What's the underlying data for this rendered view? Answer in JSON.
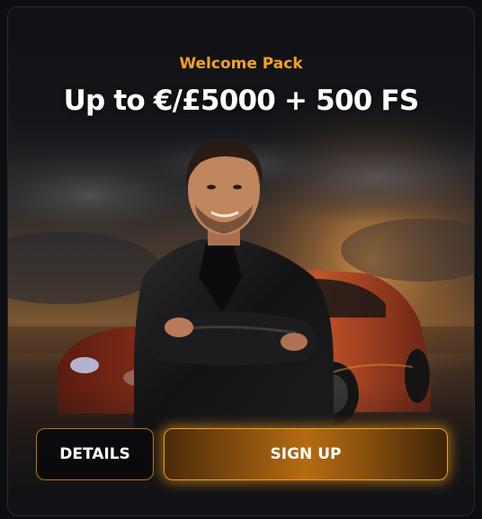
{
  "promo": {
    "eyebrow": "Welcome Pack",
    "headline": "Up to €/£5000 + 500 FS"
  },
  "actions": {
    "details_label": "DETAILS",
    "signup_label": "SIGN UP"
  },
  "colors": {
    "accent": "#f5a21a",
    "background": "#111216",
    "text": "#ffffff"
  }
}
